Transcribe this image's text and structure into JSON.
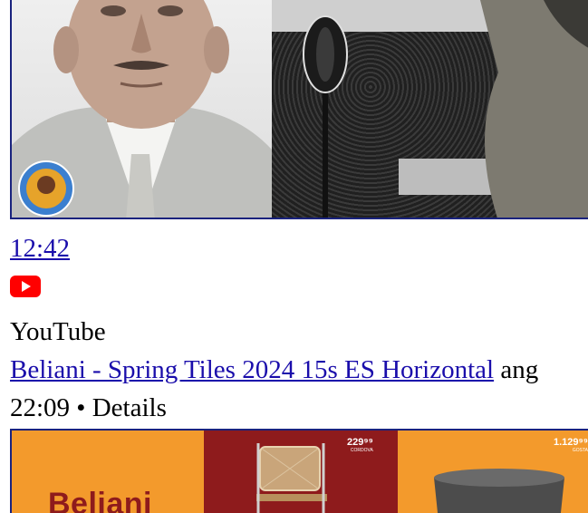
{
  "video_top": {
    "duration": "12:42",
    "source_icon": "youtube-icon",
    "source_name": "YouTube"
  },
  "video_next": {
    "title": "Beliani - Spring Tiles 2024 15s ES Horizontal",
    "title_suffix": "ang",
    "meta": "22:09 • Details",
    "thumbnail": {
      "brand": "Beliani",
      "price_1": "229⁹⁹",
      "price_1_label": "CORDOVA",
      "price_2": "1.129⁹⁹",
      "price_2_label": "GOSTA"
    }
  },
  "colors": {
    "link": "#1a0dab",
    "youtube_red": "#ff0000",
    "thumb_border": "#1a237e",
    "beliani_orange": "#f39a2c",
    "beliani_red": "#8e1b1c"
  }
}
